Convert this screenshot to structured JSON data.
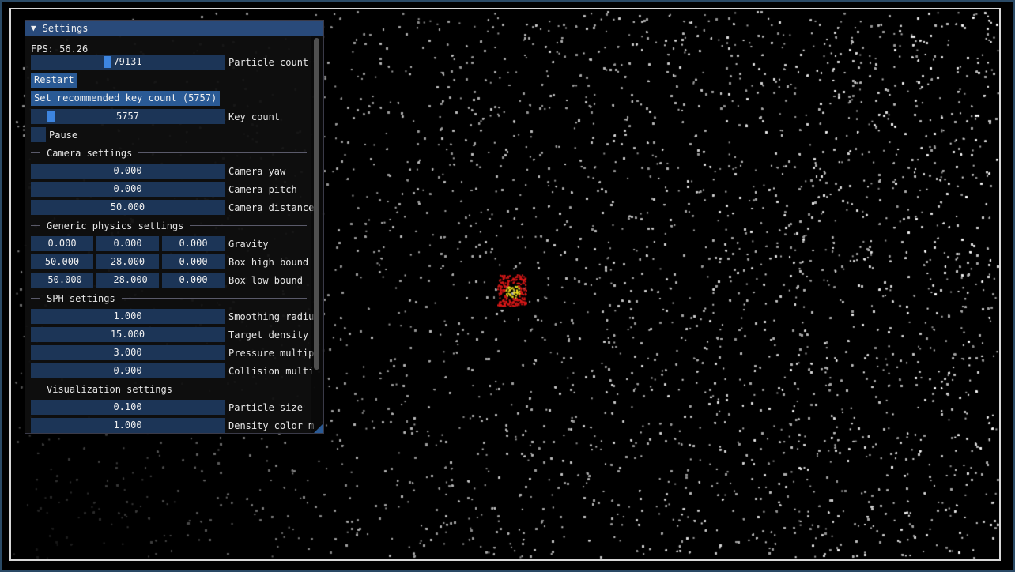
{
  "window": {
    "title": "Settings",
    "fps_label": "FPS: 56.26"
  },
  "controls": {
    "particle_count": {
      "value": "79131",
      "label": "Particle count",
      "fill": 0.39
    },
    "restart_label": "Restart",
    "recommended_key_label": "Set recommended key count (5757)",
    "key_count": {
      "value": "5757",
      "label": "Key count",
      "fill": 0.08
    },
    "pause_label": "Pause"
  },
  "camera": {
    "header": "Camera settings",
    "yaw": {
      "value": "0.000",
      "label": "Camera yaw"
    },
    "pitch": {
      "value": "0.000",
      "label": "Camera pitch"
    },
    "distance": {
      "value": "50.000",
      "label": "Camera distance"
    }
  },
  "physics": {
    "header": "Generic physics settings",
    "gravity": {
      "values": [
        "0.000",
        "0.000",
        "0.000"
      ],
      "label": "Gravity"
    },
    "high_bound": {
      "values": [
        "50.000",
        "28.000",
        "0.000"
      ],
      "label": "Box high bound"
    },
    "low_bound": {
      "values": [
        "-50.000",
        "-28.000",
        "0.000"
      ],
      "label": "Box low bound"
    }
  },
  "sph": {
    "header": "SPH settings",
    "smoothing": {
      "value": "1.000",
      "label": "Smoothing radiu"
    },
    "density": {
      "value": "15.000",
      "label": "Target density"
    },
    "pressure": {
      "value": "3.000",
      "label": "Pressure multip"
    },
    "collision": {
      "value": "0.900",
      "label": "Collision multi"
    }
  },
  "visualization": {
    "header": "Visualization settings",
    "particle_size": {
      "value": "0.100",
      "label": "Particle size"
    },
    "density_color": {
      "value": "1.000",
      "label": "Density color m"
    }
  },
  "colors": {
    "particle": "#9a9a9a",
    "particle_bright": "#e8e8e8",
    "hot_red": "#d81818",
    "hot_yellow": "#f0e020",
    "accent": "#3d85e0"
  }
}
